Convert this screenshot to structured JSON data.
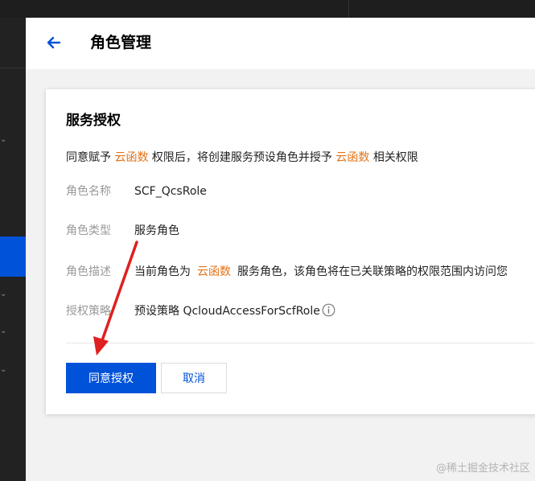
{
  "header": {
    "title": "角色管理"
  },
  "card": {
    "heading": "服务授权",
    "intro": {
      "part1": "同意赋予",
      "highlight1": "云函数",
      "part2": "权限后，将创建服务预设角色并授予",
      "highlight2": "云函数",
      "part3": "相关权限"
    },
    "fields": {
      "name_label": "角色名称",
      "name_value": "SCF_QcsRole",
      "type_label": "角色类型",
      "type_value": "服务角色",
      "desc_label": "角色描述",
      "desc_part1": "当前角色为",
      "desc_highlight": "云函数",
      "desc_part2": "服务角色，该角色将在已关联策略的权限范围内访问您",
      "policy_label": "授权策略",
      "policy_value": "预设策略 QcloudAccessForScfRole"
    },
    "buttons": {
      "confirm": "同意授权",
      "cancel": "取消"
    }
  },
  "watermark": "@稀土掘金技术社区",
  "colors": {
    "primary": "#0052d9",
    "highlight": "#e37318",
    "annotation_arrow": "#e02020"
  },
  "icons": [
    "back-arrow-icon",
    "info-icon",
    "chevron-down-icon"
  ]
}
